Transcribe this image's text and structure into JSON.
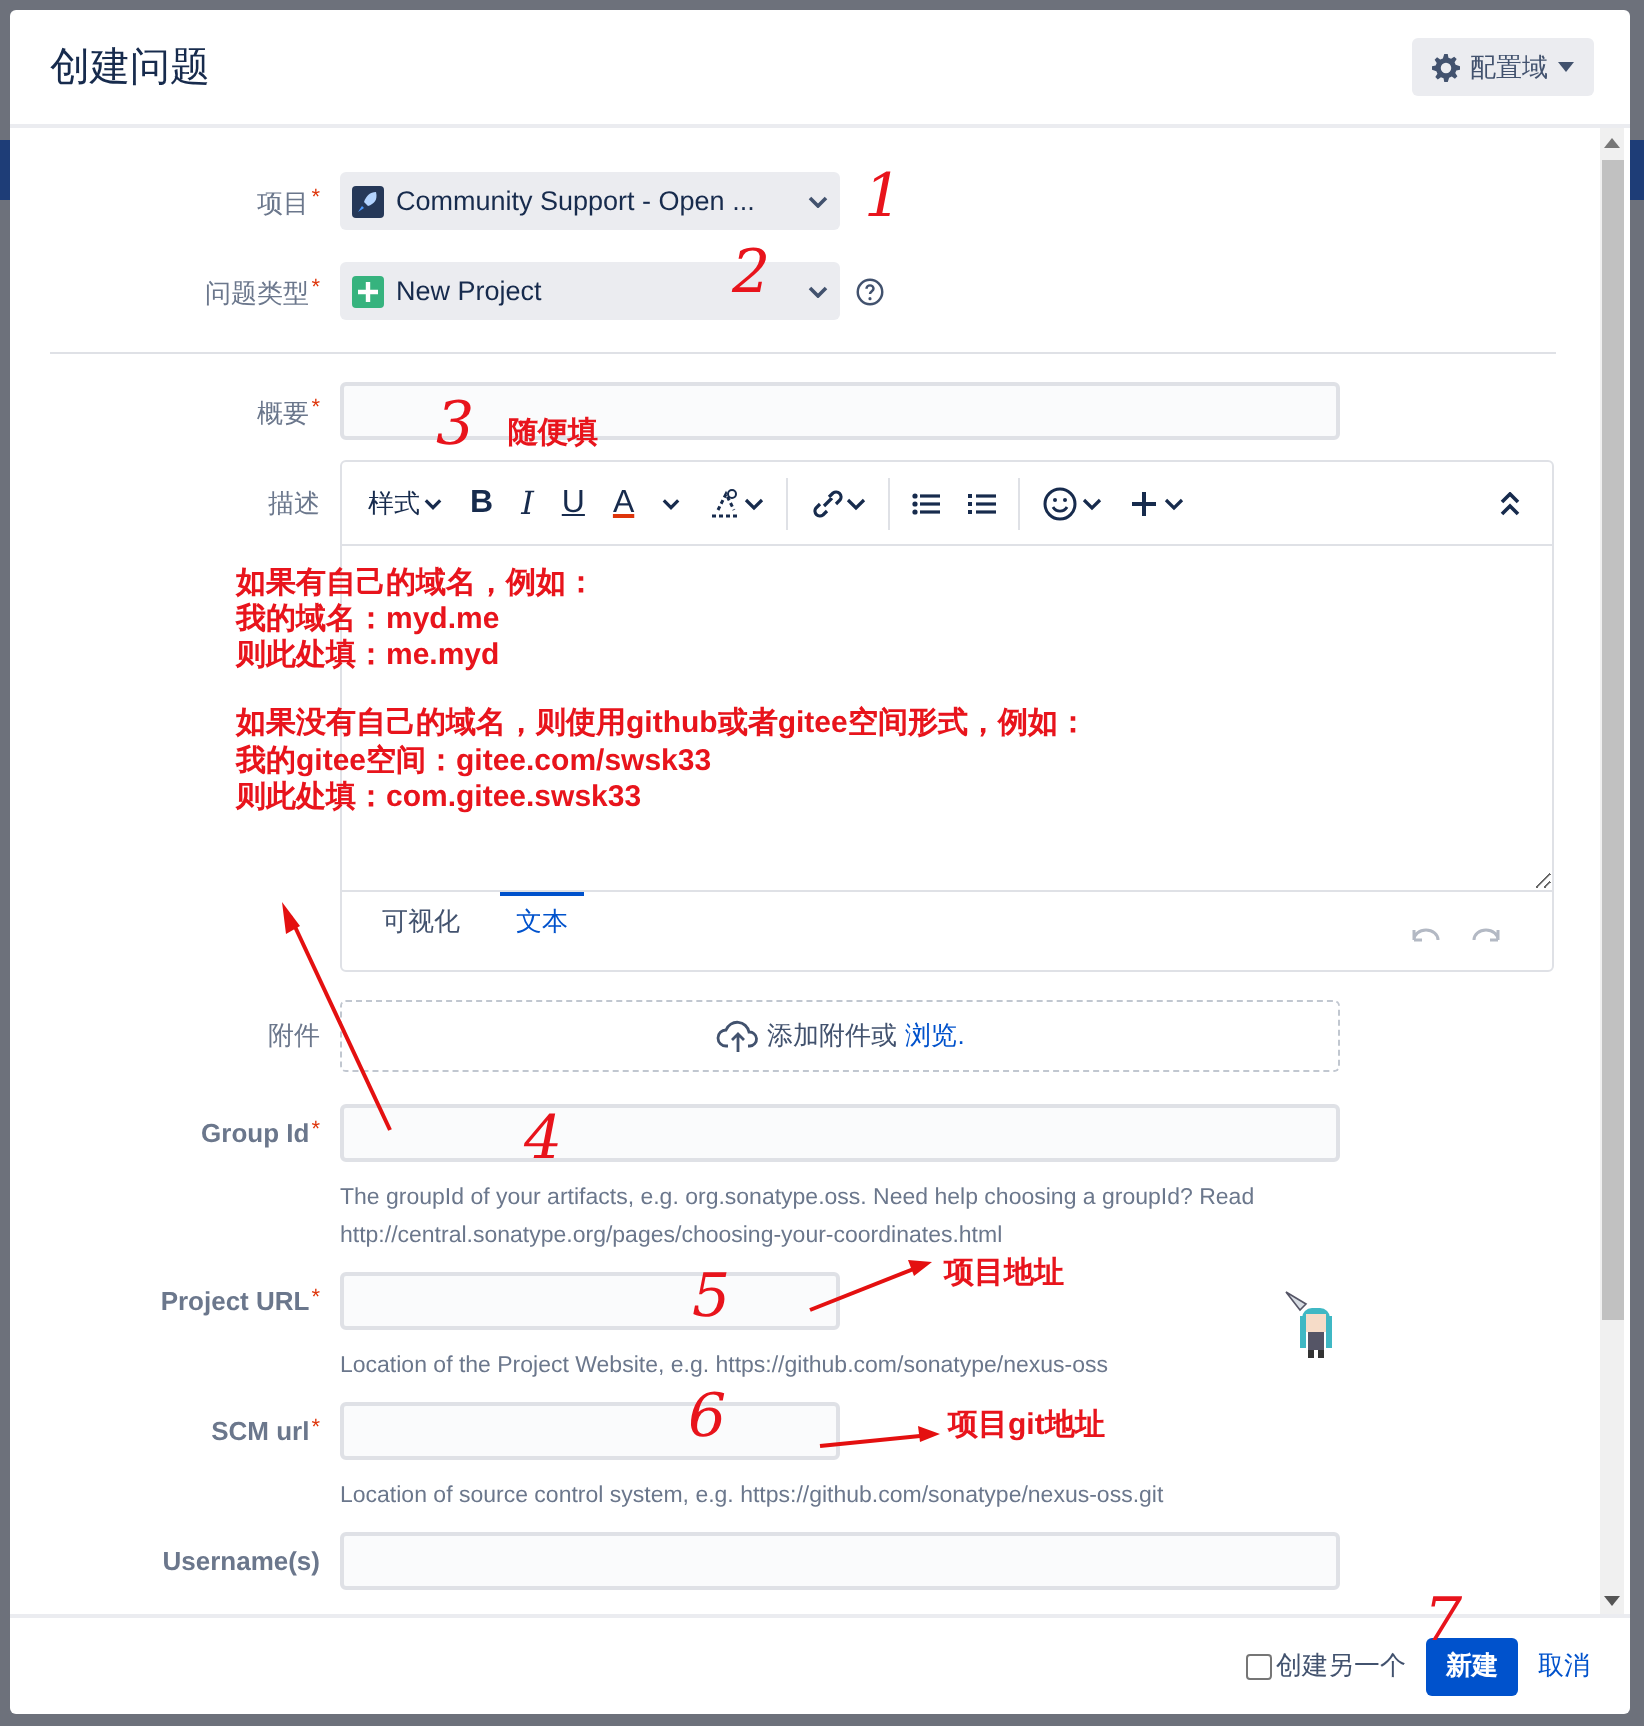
{
  "dialog": {
    "title": "创建问题",
    "config_button": "配置域"
  },
  "fields": [
    {
      "kind": "select",
      "label": "项目",
      "required_mark": "*",
      "bold_label": false,
      "value": "Community Support - Open ...",
      "help_icon": false
    },
    {
      "kind": "select",
      "label": "问题类型",
      "required_mark": "*",
      "bold_label": false,
      "value": "New Project",
      "help_icon": true
    },
    {
      "kind": "divider"
    },
    {
      "kind": "text",
      "label": "概要",
      "required_mark": "*",
      "bold_label": false
    },
    {
      "kind": "editor",
      "label": "描述",
      "bold_label": false,
      "toolbar": [
        {
          "kind": "dropdown",
          "label": "样式"
        },
        {
          "kind": "bold",
          "label": "B"
        },
        {
          "kind": "italic",
          "label": "I"
        },
        {
          "kind": "underline",
          "label": "U"
        },
        {
          "kind": "color",
          "label": "A"
        },
        {
          "kind": "caret"
        },
        {
          "kind": "format"
        },
        {
          "kind": "sep"
        },
        {
          "kind": "link"
        },
        {
          "kind": "sep"
        },
        {
          "kind": "bullets"
        },
        {
          "kind": "numbers"
        },
        {
          "kind": "sep"
        },
        {
          "kind": "emoji"
        },
        {
          "kind": "plus"
        },
        {
          "kind": "collapse"
        }
      ],
      "tabs": [
        {
          "label": "可视化",
          "selected": false
        },
        {
          "label": "文本",
          "selected": true
        }
      ]
    },
    {
      "kind": "attachment",
      "label": "附件",
      "bold_label": false,
      "text": "添加附件或",
      "link": "浏览."
    },
    {
      "kind": "text",
      "label": "Group Id",
      "required_mark": "*",
      "bold_label": true,
      "help": "The groupId of your artifacts, e.g. org.sonatype.oss. Need help choosing a groupId? Read http://central.sonatype.org/pages/choosing-your-coordinates.html"
    },
    {
      "kind": "short-text",
      "label": "Project URL",
      "required_mark": "*",
      "bold_label": true,
      "help": "Location of the Project Website, e.g. https://github.com/sonatype/nexus-oss"
    },
    {
      "kind": "short-text",
      "label": "SCM url",
      "required_mark": "*",
      "bold_label": true,
      "help": "Location of source control system, e.g. https://github.com/sonatype/nexus-oss.git"
    },
    {
      "kind": "text",
      "label": "Username(s)",
      "bold_label": true
    }
  ],
  "footer": {
    "create_another": {
      "label": "创建另一个",
      "checked": false
    },
    "submit": "新建",
    "cancel": "取消"
  },
  "annotations": [
    {
      "kind": "number",
      "text": "1"
    },
    {
      "kind": "number",
      "text": "2"
    },
    {
      "kind": "number",
      "text": "3"
    },
    {
      "kind": "note",
      "text": "随便填"
    },
    {
      "kind": "note",
      "text": "如果有自己的域名，例如："
    },
    {
      "kind": "note",
      "text": "我的域名：myd.me"
    },
    {
      "kind": "note",
      "text": "则此处填：me.myd"
    },
    {
      "kind": "note",
      "text": "如果没有自己的域名，则使用github或者gitee空间形式，例如："
    },
    {
      "kind": "note",
      "text": "我的gitee空间：gitee.com/swsk33"
    },
    {
      "kind": "note",
      "text": "则此处填：com.gitee.swsk33"
    },
    {
      "kind": "number",
      "text": "4"
    },
    {
      "kind": "number",
      "text": "5"
    },
    {
      "kind": "note",
      "text": "项目地址"
    },
    {
      "kind": "number",
      "text": "6"
    },
    {
      "kind": "note",
      "text": "项目git地址"
    },
    {
      "kind": "number",
      "text": "7"
    }
  ]
}
